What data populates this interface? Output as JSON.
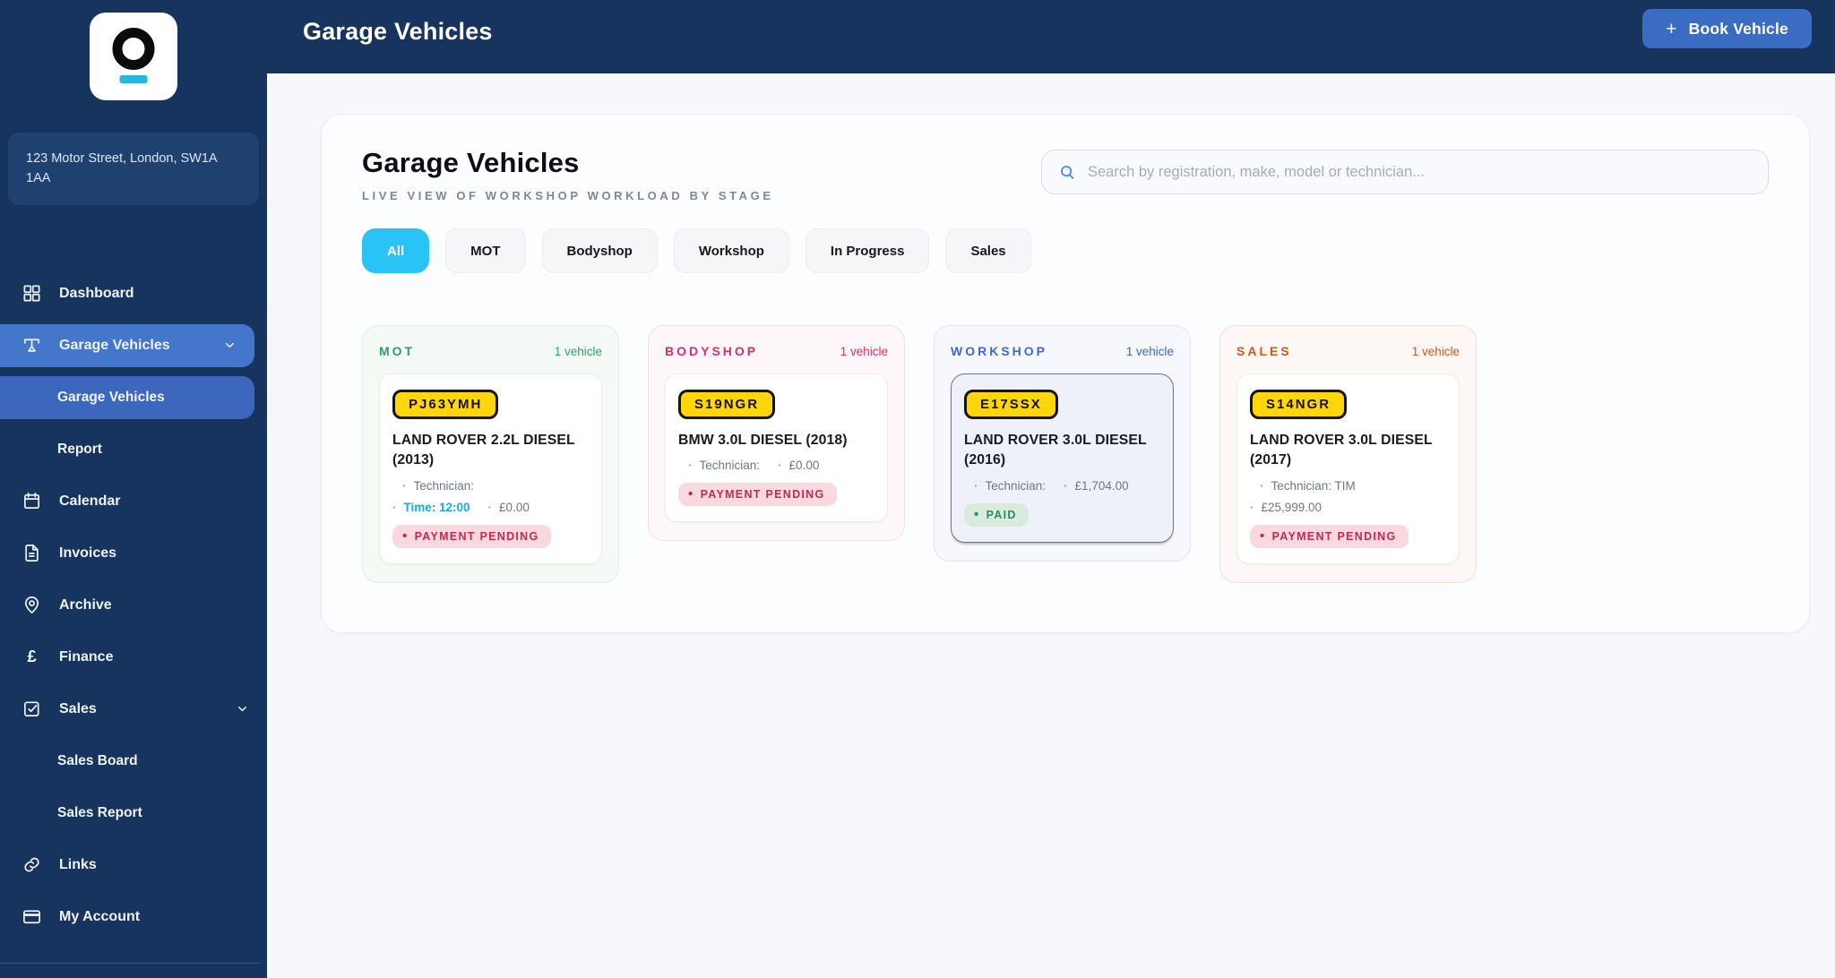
{
  "sidebar": {
    "address": "123 Motor Street, London, SW1A 1AA",
    "items": [
      {
        "label": "Dashboard",
        "icon": "grid-icon"
      },
      {
        "label": "Garage Vehicles",
        "icon": "vehicle-lift-icon",
        "expanded": true,
        "active": true
      },
      {
        "label": "Garage Vehicles",
        "sub": true,
        "active": true
      },
      {
        "label": "Report",
        "sub": true
      },
      {
        "label": "Calendar",
        "icon": "calendar-icon"
      },
      {
        "label": "Invoices",
        "icon": "invoice-icon"
      },
      {
        "label": "Archive",
        "icon": "map-pin-icon"
      },
      {
        "label": "Finance",
        "icon": "pound-icon"
      },
      {
        "label": "Sales",
        "icon": "check-square-icon",
        "expanded": true
      },
      {
        "label": "Sales Board",
        "sub": true
      },
      {
        "label": "Sales Report",
        "sub": true
      },
      {
        "label": "Links",
        "icon": "link-icon"
      },
      {
        "label": "My Account",
        "icon": "credit-card-icon"
      }
    ]
  },
  "header": {
    "title": "Garage Vehicles",
    "plus": "+",
    "book_label": "Book Vehicle"
  },
  "main": {
    "title": "Garage Vehicles",
    "subtitle": "LIVE VIEW OF WORKSHOP WORKLOAD BY STAGE",
    "search_placeholder": "Search by registration, make, model or technician...",
    "filters": [
      "All",
      "MOT",
      "Bodyshop",
      "Workshop",
      "In Progress",
      "Sales"
    ],
    "active_filter": "All"
  },
  "board": {
    "columns": [
      {
        "name": "MOT",
        "count": "1 vehicle",
        "accent": "#2F9E68",
        "card": {
          "plate": "PJ63YMH",
          "title": "LAND ROVER 2.2L DIESEL (2013)",
          "technician_label": "Technician:",
          "time": "Time: 12:00",
          "price": "£0.00",
          "status": "PAYMENT PENDING",
          "status_type": "pending"
        }
      },
      {
        "name": "BODYSHOP",
        "count": "1 vehicle",
        "accent": "#D63069",
        "card": {
          "plate": "S19NGR",
          "title": "BMW 3.0L DIESEL (2018)",
          "technician_label": "Technician:",
          "price": "£0.00",
          "status": "PAYMENT PENDING",
          "status_type": "pending"
        }
      },
      {
        "name": "WORKSHOP",
        "count": "1 vehicle",
        "accent": "#3E68CE",
        "card": {
          "plate": "E17SSX",
          "title": "LAND ROVER 3.0L DIESEL (2016)",
          "technician_label": "Technician:",
          "price": "£1,704.00",
          "status": "PAID",
          "status_type": "paid",
          "selected": true
        }
      },
      {
        "name": "SALES",
        "count": "1 vehicle",
        "accent": "#D2571E",
        "card": {
          "plate": "S14NGR",
          "title": "LAND ROVER 3.0L DIESEL (2017)",
          "technician_label": "Technician: TIM",
          "price": "£25,999.00",
          "status": "PAYMENT PENDING",
          "status_type": "pending"
        }
      }
    ]
  },
  "colors": {
    "sidebar_bg": "#16345E",
    "header_bg": "#16345E",
    "nav_active_parent": "#4476CB",
    "nav_active_sub": "#3C67BD",
    "book_button": "#3A6CC1",
    "active_pill_cyan": "#29C4F5",
    "logo_bar_cyan": "#26B8DC",
    "plate_yellow": "#FFD60A",
    "time_blue": "#1BA9E8",
    "badge_pending_bg": "#FAD9DE",
    "badge_pending_text": "#C12A56",
    "badge_paid_bg": "#D9EBDD",
    "badge_paid_text": "#2E8B5F",
    "accent_mot": "#2F9E68",
    "accent_bodyshop": "#D63069",
    "accent_workshop": "#3E68CE",
    "accent_sales": "#D2571E"
  }
}
